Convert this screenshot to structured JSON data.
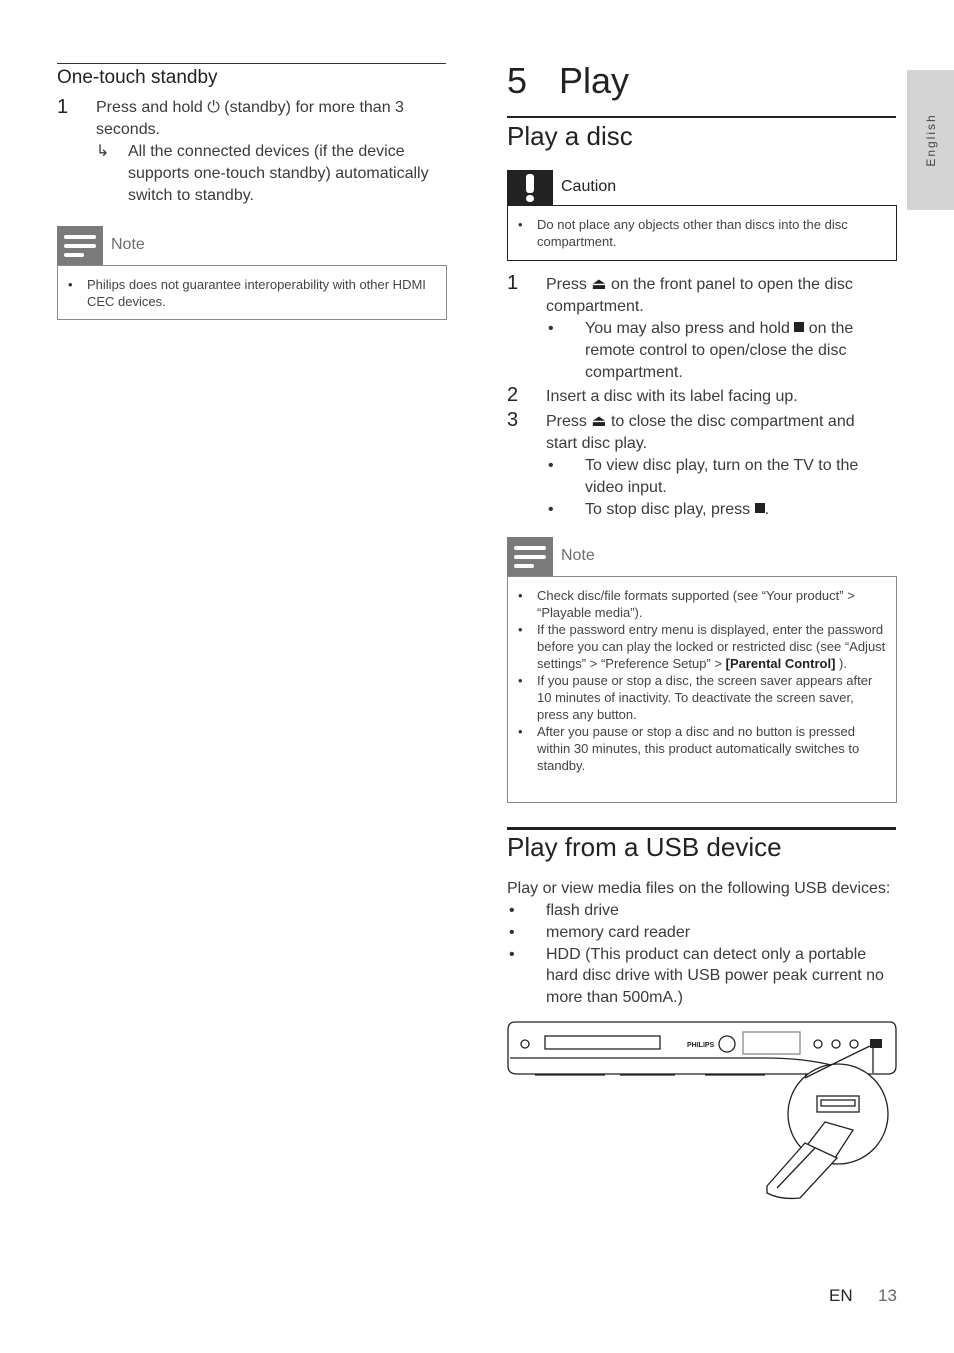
{
  "side_tab": {
    "label": "English"
  },
  "left": {
    "section_title": "One-touch standby",
    "steps": [
      {
        "num": "1",
        "text_before": "Press and hold",
        "icon": "power-icon",
        "text_after": "(standby) for more than 3 seconds.",
        "result": "All the connected devices (if the device supports one-touch standby) automatically switch to standby."
      }
    ],
    "note": {
      "label": "Note",
      "items": [
        "Philips does not guarantee interoperability with other HDMI CEC devices."
      ]
    }
  },
  "right": {
    "chapter_num": "5",
    "chapter_title": "Play",
    "section1": {
      "title": "Play a disc",
      "caution": {
        "label": "Caution",
        "items": [
          "Do not place any objects other than discs into the disc compartment."
        ]
      },
      "steps": [
        {
          "num": "1",
          "pre": "Press",
          "icon": "eject-icon",
          "post": "on the front panel to open the disc compartment.",
          "sub": [
            {
              "pre": "You may also press and hold",
              "icon": "stop-icon",
              "post": "on the remote control to open/close the disc compartment."
            }
          ]
        },
        {
          "num": "2",
          "text": "Insert a disc with its label facing up."
        },
        {
          "num": "3",
          "pre": "Press",
          "icon": "eject-icon",
          "post": "to close the disc compartment and start disc play.",
          "sub": [
            {
              "text": "To view disc play, turn on the TV to the video input."
            },
            {
              "pre": "To stop disc play, press",
              "icon": "stop-icon",
              "post": "."
            }
          ]
        }
      ],
      "note": {
        "label": "Note",
        "items": [
          "Check disc/file formats supported (see “Your product” > “Playable media”).",
          "If the password entry menu is displayed, enter the password before you can play the locked or restricted disc (see “Adjust settings” > “Preference Setup” >",
          "If you pause or stop a disc, the screen saver appears after 10 minutes of inactivity. To deactivate the screen saver, press any button.",
          "After you pause or stop a disc and no button is pressed within 30 minutes, this product automatically switches to standby."
        ],
        "item2_bold": "[Parental Control]",
        "item2_tail": " )."
      }
    },
    "section2": {
      "title": "Play from a USB device",
      "intro": "Play or view media files on the following USB devices:",
      "items": [
        "flash drive",
        "memory card reader",
        "HDD (This product can detect only a portable hard disc drive with USB power peak current no more than 500mA.)"
      ]
    },
    "illustration": {
      "brand": "PHILIPS"
    }
  },
  "footer": {
    "lang": "EN",
    "page": "13"
  }
}
